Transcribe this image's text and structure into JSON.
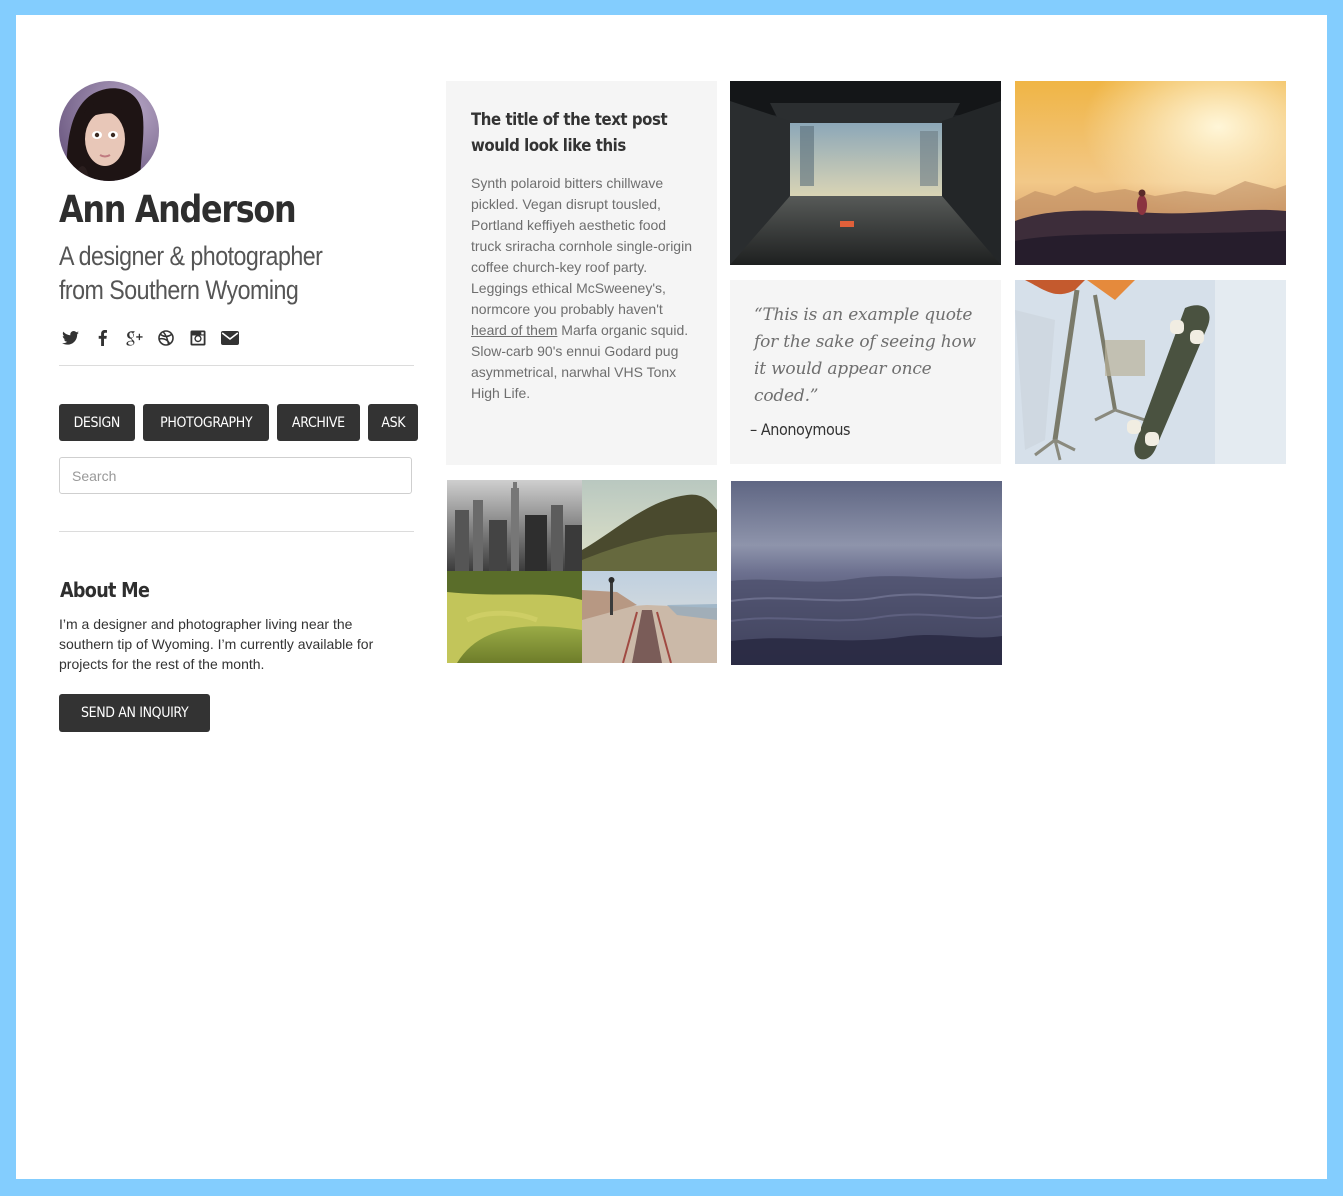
{
  "profile": {
    "name": "Ann Anderson",
    "tagline": "A designer & photographer from Southern Wyoming"
  },
  "socials": [
    {
      "icon": "twitter-icon"
    },
    {
      "icon": "facebook-icon"
    },
    {
      "icon": "google-plus-icon"
    },
    {
      "icon": "dribbble-icon"
    },
    {
      "icon": "instagram-icon"
    },
    {
      "icon": "envelope-icon"
    }
  ],
  "nav": {
    "items": [
      {
        "label": "DESIGN"
      },
      {
        "label": "PHOTOGRAPHY"
      },
      {
        "label": "ARCHIVE"
      },
      {
        "label": "ASK"
      }
    ]
  },
  "search": {
    "placeholder": "Search",
    "value": ""
  },
  "about": {
    "title": "About Me",
    "text": "I’m a designer and photographer living near the southern tip of Wyoming. I’m currently available for projects for the rest of the month.",
    "button_label": "SEND AN INQUIRY"
  },
  "text_post": {
    "title": "The title of the text post would look like this",
    "body_before": "Synth polaroid bitters chillwave pickled. Vegan disrupt tousled, Portland keffiyeh aesthetic food truck sriracha cornhole single-origin coffee church-key roof party. Leggings ethical McSweeney's, normcore you probably haven't ",
    "link_text": "heard of them",
    "body_after": " Marfa organic squid. Slow-carb 90's ennui Godard pug asymmetrical, narwhal VHS Tonx High Life."
  },
  "quote_post": {
    "quote": "“This is an example quote for the sake of seeing how it would appear once coded.”",
    "source": "– Anonoymous"
  },
  "colors": {
    "frame": "#83cdfe",
    "button": "#333333",
    "tile_bg": "#f5f5f5"
  }
}
